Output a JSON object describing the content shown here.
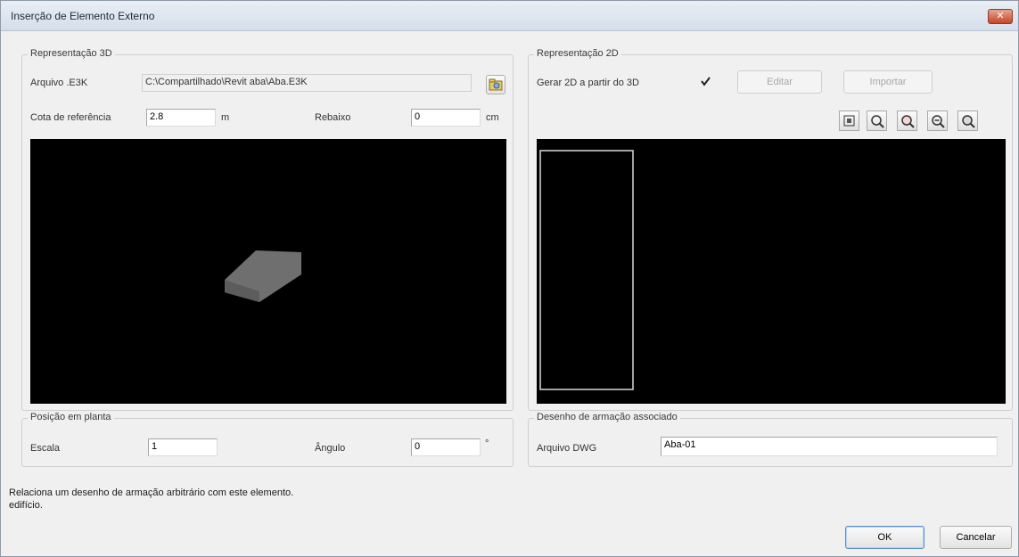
{
  "window": {
    "title": "Inserção de Elemento Externo",
    "close_glyph": "✕"
  },
  "group3d": {
    "label": "Representação 3D",
    "file_label": "Arquivo .E3K",
    "file_path": "C:\\Compartilhado\\Revit aba\\Aba.E3K",
    "browse_icon": "folder-open-icon",
    "ref_label": "Cota de referência",
    "ref_value": "2.8",
    "ref_unit": "m",
    "rebaixo_label": "Rebaixo",
    "rebaixo_value": "0",
    "rebaixo_unit": "cm"
  },
  "group2d": {
    "label": "Representação 2D",
    "generate_label": "Gerar 2D a partir do 3D",
    "generate_checked": true,
    "edit_label": "Editar",
    "import_label": "Importar",
    "toolbar_icons": [
      "zoom-all-icon",
      "zoom-window-icon",
      "zoom-in-icon",
      "zoom-out-icon",
      "pan-icon"
    ]
  },
  "plan": {
    "label": "Posição em planta",
    "scale_label": "Escala",
    "scale_value": "1",
    "angle_label": "Ângulo",
    "angle_value": "0",
    "angle_unit": "°"
  },
  "drawing": {
    "label": "Desenho de armação associado",
    "dwg_label": "Arquivo DWG",
    "dwg_value": "Aba-01"
  },
  "status": {
    "line1": "Relaciona um desenho de armação arbitrário com este elemento.",
    "line2": "edifício."
  },
  "buttons": {
    "ok": "OK",
    "cancel": "Cancelar"
  },
  "colors": {
    "viewport_bg": "#000000",
    "slab_fill": "#6e6e6e",
    "outline_2d": "#d9d9d9"
  }
}
